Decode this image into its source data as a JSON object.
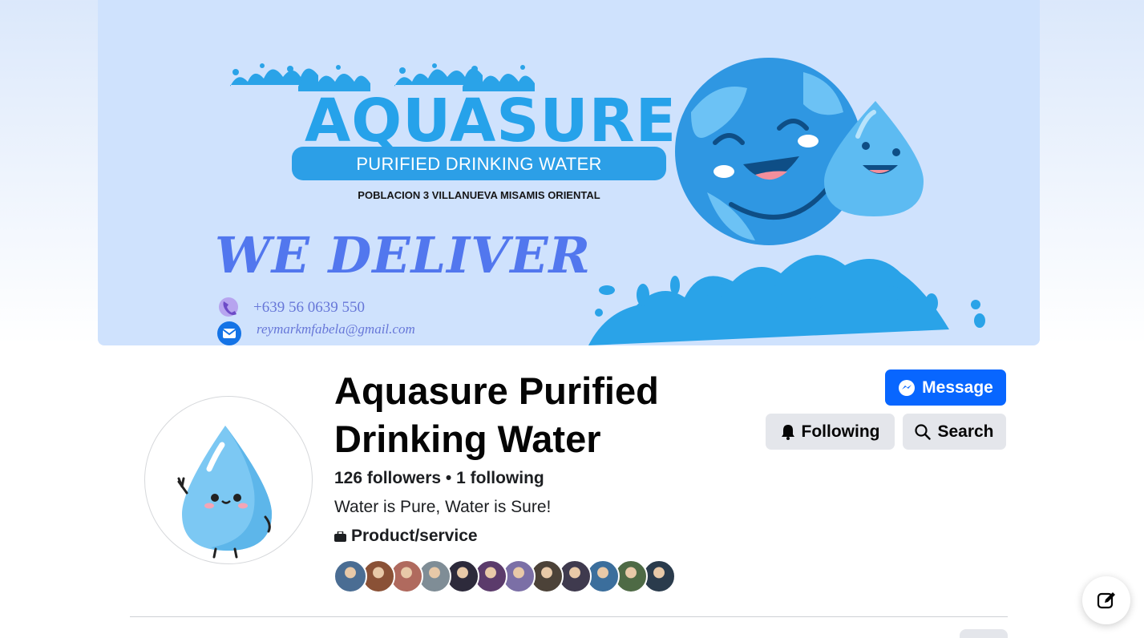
{
  "cover": {
    "brand": "AQUASURE",
    "subtitle": "PURIFIED DRINKING WATER",
    "address": "POBLACION 3 VILLANUEVA MISAMIS ORIENTAL",
    "slogan": "WE DELIVER",
    "phone": "+639 56 0639 550",
    "email": "reymarkmfabela@gmail.com"
  },
  "profile": {
    "name": "Aquasure Purified Drinking Water",
    "counts": "126 followers • 1 following",
    "tagline": "Water is Pure, Water is Sure!",
    "category": "Product/service"
  },
  "actions": {
    "message": "Message",
    "following": "Following",
    "search": "Search"
  },
  "follower_avatars": [
    {
      "color": "#4a6d93"
    },
    {
      "color": "#8a5136"
    },
    {
      "color": "#b06a5e"
    },
    {
      "color": "#7f8d96"
    },
    {
      "color": "#2d2a3b"
    },
    {
      "color": "#5b3b6b"
    },
    {
      "color": "#7b6fa6"
    },
    {
      "color": "#4c4238"
    },
    {
      "color": "#3f3a4e"
    },
    {
      "color": "#3b6e9c"
    },
    {
      "color": "#4e6a45"
    },
    {
      "color": "#2a3b4c"
    }
  ],
  "colors": {
    "primary": "#0866ff",
    "secondary_button": "#e4e6eb",
    "brand_blue": "#26a2ea",
    "deliver_blue": "#5277ee"
  }
}
